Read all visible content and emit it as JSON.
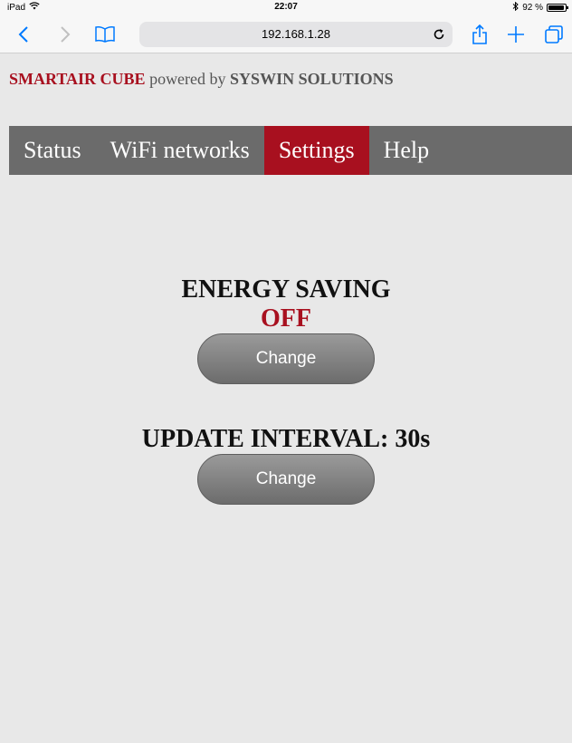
{
  "status_bar": {
    "device": "iPad",
    "time": "22:07",
    "battery": "92 %",
    "battery_level": 0.92
  },
  "browser": {
    "url": "192.168.1.28",
    "icons": {
      "back": "chevron-left-icon",
      "forward": "chevron-right-icon",
      "bookmarks": "book-icon",
      "reload": "reload-icon",
      "share": "share-icon",
      "new_tab": "plus-icon",
      "tabs": "tabs-icon"
    }
  },
  "brand": {
    "name": "SMARTAIR CUBE",
    "powered_by": "powered by",
    "company": "SYSWIN SOLUTIONS"
  },
  "nav": {
    "items": [
      {
        "label": "Status"
      },
      {
        "label": "WiFi networks"
      },
      {
        "label": "Settings",
        "active": true
      },
      {
        "label": "Help"
      }
    ]
  },
  "energy_saving": {
    "heading": "ENERGY SAVING",
    "state": "OFF",
    "button_label": "Change"
  },
  "update_interval": {
    "heading": "UPDATE INTERVAL: 30s",
    "button_label": "Change"
  },
  "colors": {
    "accent": "#a8101f",
    "nav_bg": "#6b6b6b",
    "page_bg": "#e8e8e8",
    "ios_blue": "#007aff"
  }
}
